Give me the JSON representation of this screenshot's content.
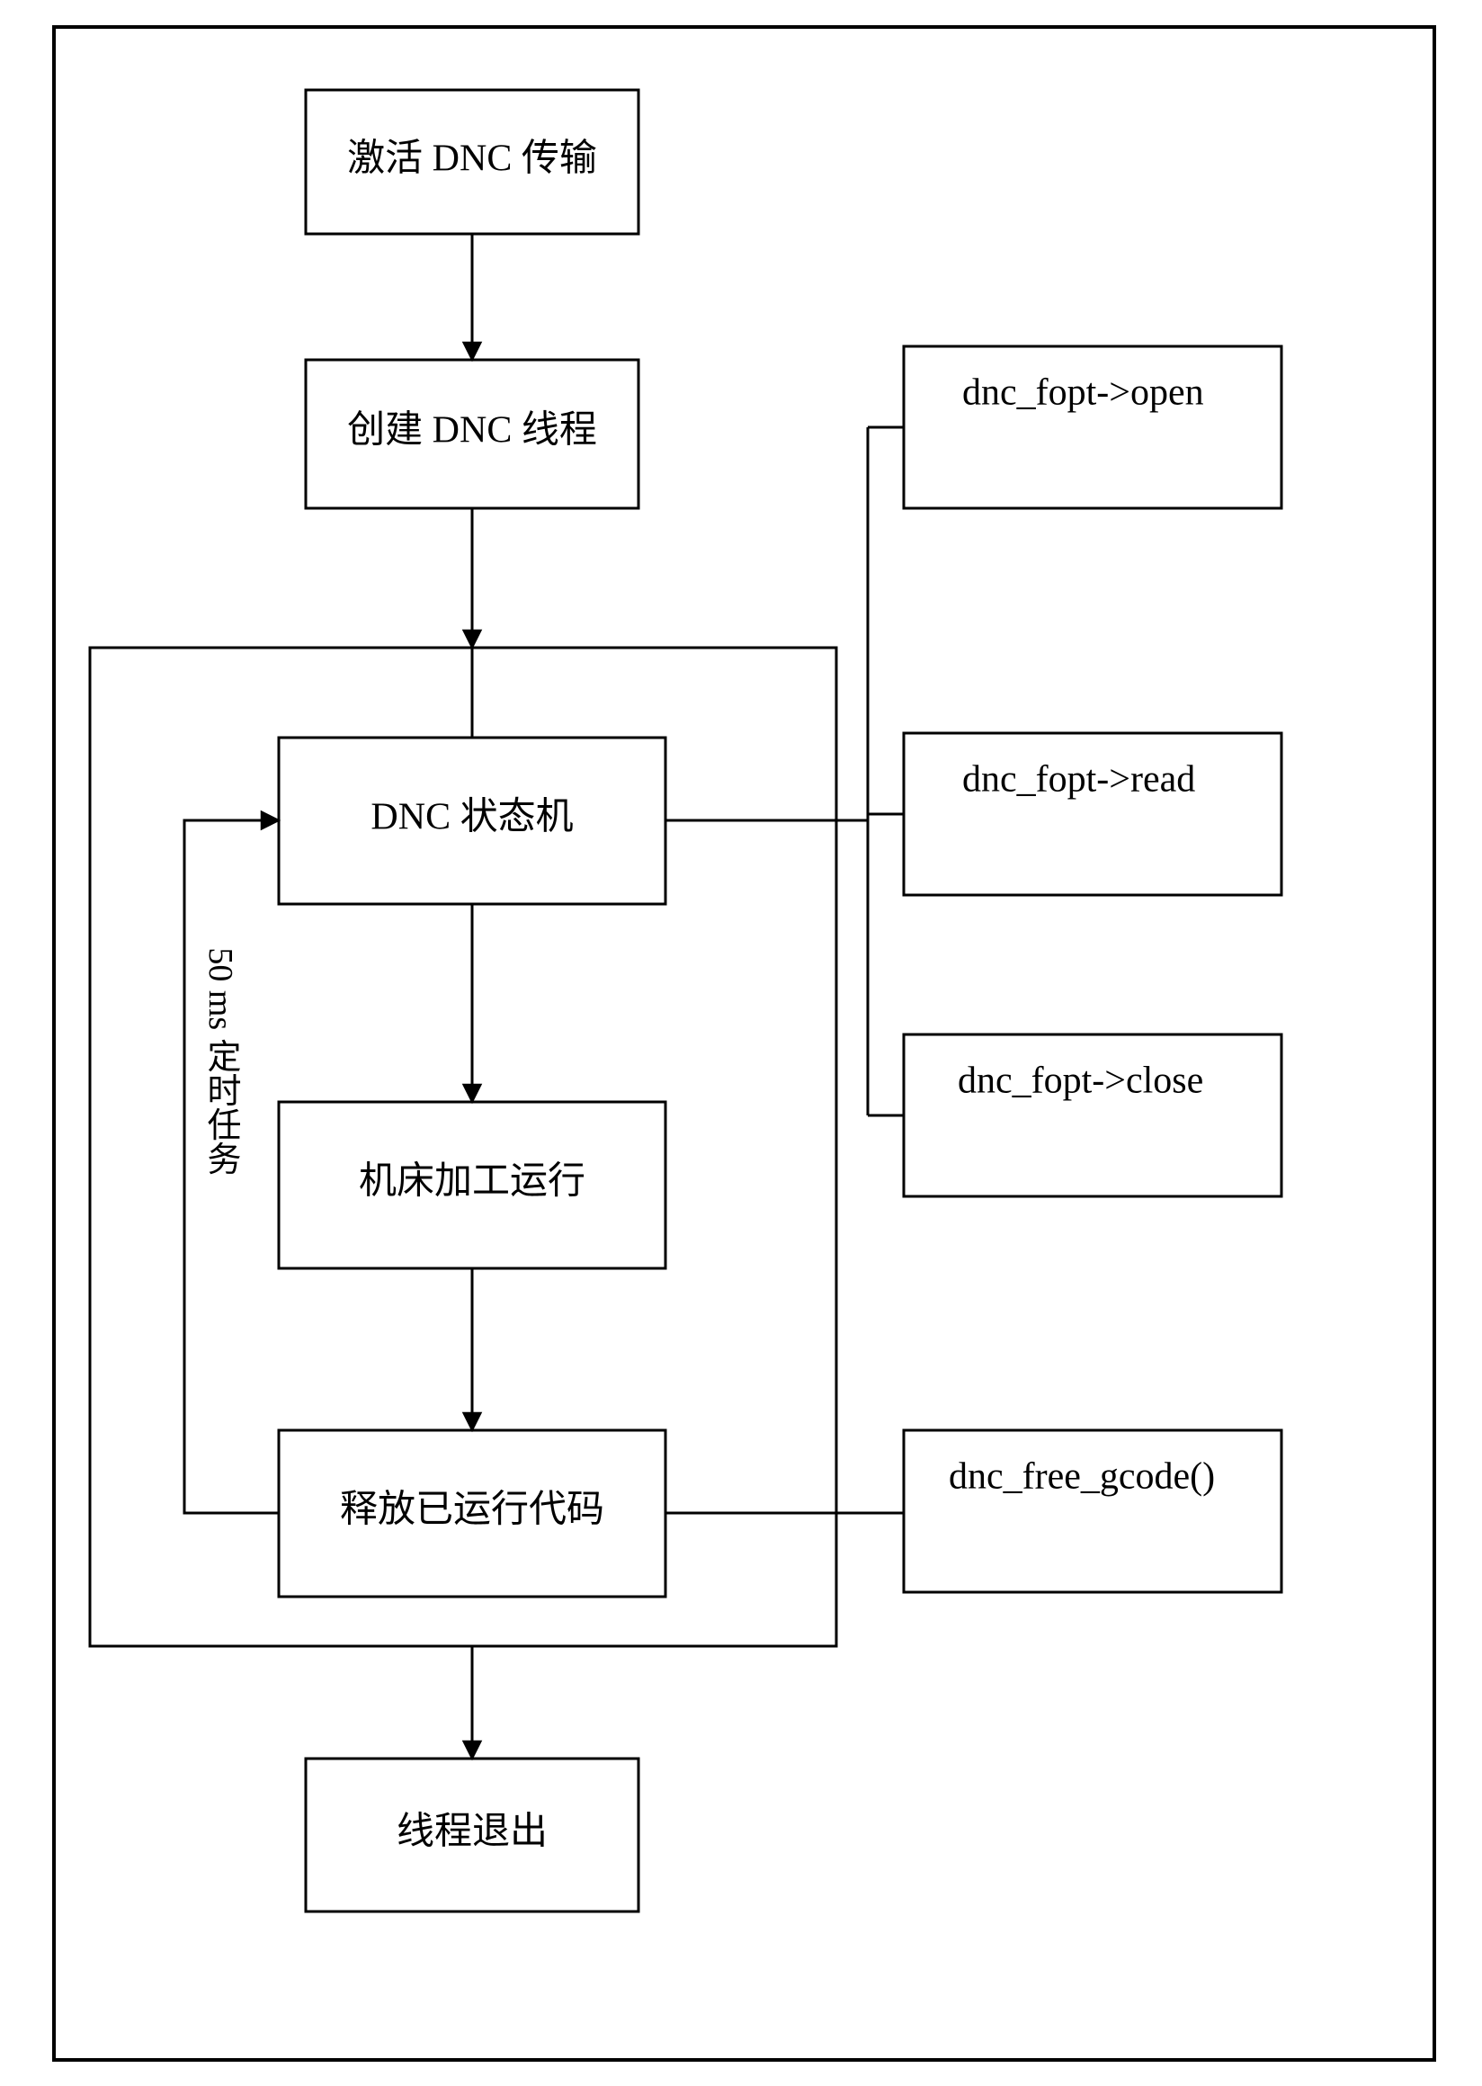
{
  "nodes": {
    "activate": "激活 DNC 传输",
    "create": "创建 DNC 线程",
    "statemachine": "DNC  状态机",
    "machine": "机床加工运行",
    "release": "释放已运行代码",
    "exit": "线程退出",
    "open": "dnc_fopt->open",
    "read": "dnc_fopt->read",
    "close": "dnc_fopt->close",
    "free": "dnc_free_gcode()"
  },
  "loop_label": "50 ms  定时任务"
}
